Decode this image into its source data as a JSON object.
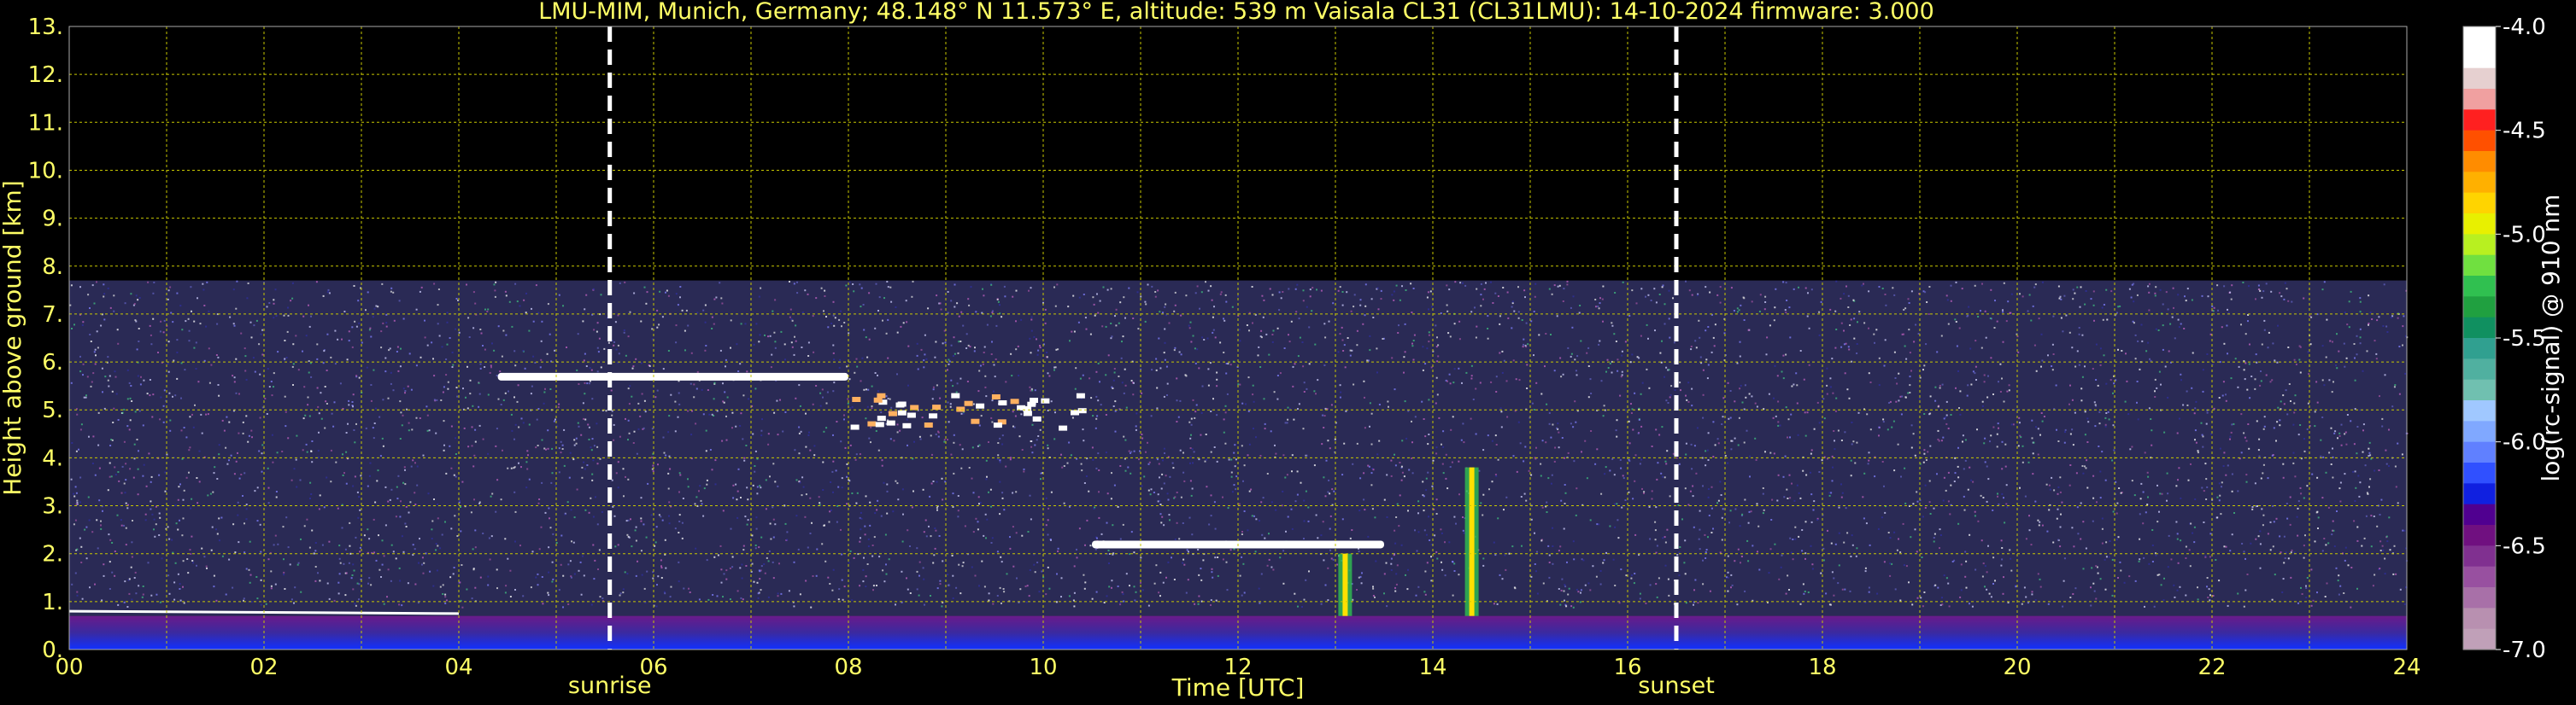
{
  "chart_data": {
    "type": "heatmap",
    "title": "LMU-MIM, Munich, Germany; 48.148° N 11.573° E, altitude: 539 m    Vaisala CL31 (CL31LMU): 14-10-2024    firmware: 3.000",
    "xlabel": "Time [UTC]",
    "ylabel": "Height above ground [km]",
    "xlim": [
      0,
      24
    ],
    "ylim": [
      0,
      13
    ],
    "x_ticks": [
      "00",
      "02",
      "04",
      "06",
      "08",
      "10",
      "12",
      "14",
      "16",
      "18",
      "20",
      "22",
      "24"
    ],
    "y_ticks": [
      "0.",
      "1.",
      "2.",
      "3.",
      "4.",
      "5.",
      "6.",
      "7.",
      "8.",
      "9.",
      "10.",
      "11.",
      "12.",
      "13."
    ],
    "grid": true,
    "data_top_km": 7.7,
    "events": [
      {
        "label": "sunrise",
        "time": 5.55
      },
      {
        "label": "sunset",
        "time": 16.5
      }
    ],
    "colorbar": {
      "label": "log(rc-signal) @ 910 nm",
      "range": [
        -7.0,
        -4.0
      ],
      "ticks": [
        "-4.0",
        "-4.5",
        "-5.0",
        "-5.5",
        "-6.0",
        "-6.5",
        "-7.0"
      ],
      "colors": [
        "#ffffff",
        "#ffffff",
        "#e6d0d0",
        "#f0a0a0",
        "#ff2020",
        "#ff5000",
        "#ff8c00",
        "#ffb000",
        "#ffd400",
        "#e8f000",
        "#b8f020",
        "#70e040",
        "#30c050",
        "#20a040",
        "#109060",
        "#30a090",
        "#50b0a0",
        "#70c0b0",
        "#a0c8ff",
        "#80a8ff",
        "#6080ff",
        "#3050ff",
        "#1020e0",
        "#500090",
        "#701080",
        "#803090",
        "#9850a0",
        "#a870a8",
        "#b890b0",
        "#c0a0b8"
      ]
    },
    "features": [
      {
        "type": "cloud_layer",
        "t_start": 4.4,
        "t_end": 8.0,
        "height_km": 5.7
      },
      {
        "type": "cloud_field",
        "t_start": 8.0,
        "t_end": 10.5,
        "height_km": 5.0
      },
      {
        "type": "cloud_layer",
        "t_start": 10.5,
        "t_end": 13.5,
        "height_km": 2.2
      },
      {
        "type": "precipitation_streak",
        "time": 13.1,
        "base_km": 0.0,
        "top_km": 2.0
      },
      {
        "type": "precipitation_streak",
        "time": 14.4,
        "base_km": 0.0,
        "top_km": 3.8
      },
      {
        "type": "boundary_layer",
        "t_start": 0.0,
        "t_end": 24.0,
        "height_km": 0.7
      }
    ]
  }
}
